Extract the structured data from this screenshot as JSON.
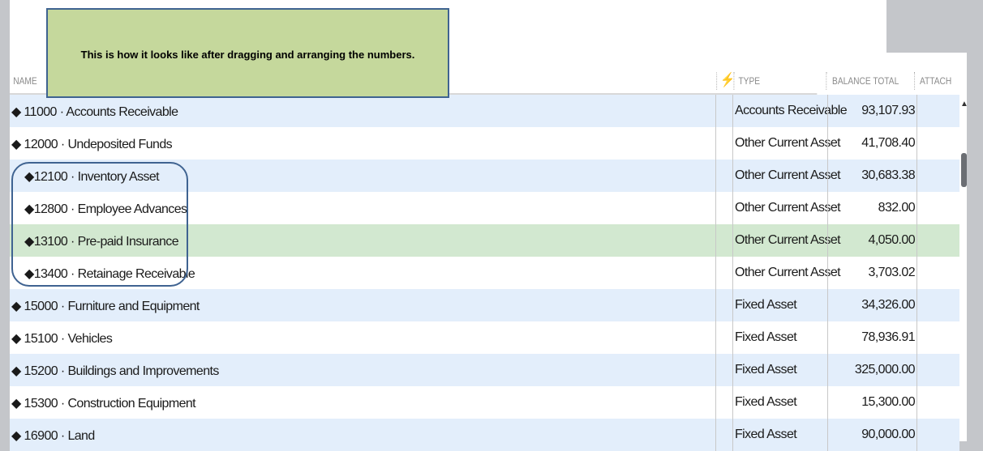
{
  "callout": "This is how it looks like after dragging and arranging the numbers.",
  "columns": {
    "name": "NAME",
    "type": "TYPE",
    "balance": "BALANCE TOTAL",
    "attach": "ATTACH"
  },
  "rows": [
    {
      "name": "◆ 11000 · Accounts Receivable",
      "type": "Accounts Receivable",
      "balance": "93,107.93",
      "sub": false
    },
    {
      "name": "◆ 12000 · Undeposited Funds",
      "type": "Other Current Asset",
      "balance": "41,708.40",
      "sub": false
    },
    {
      "name": "◆12100 · Inventory Asset",
      "type": "Other Current Asset",
      "balance": "30,683.38",
      "sub": true
    },
    {
      "name": "◆12800 · Employee Advances",
      "type": "Other Current Asset",
      "balance": "832.00",
      "sub": true
    },
    {
      "name": "◆13100 · Pre-paid Insurance",
      "type": "Other Current Asset",
      "balance": "4,050.00",
      "sub": true
    },
    {
      "name": "◆13400 · Retainage Receivable",
      "type": "Other Current Asset",
      "balance": "3,703.02",
      "sub": true
    },
    {
      "name": "◆ 15000 · Furniture and Equipment",
      "type": "Fixed Asset",
      "balance": "34,326.00",
      "sub": false
    },
    {
      "name": "◆ 15100 · Vehicles",
      "type": "Fixed Asset",
      "balance": "78,936.91",
      "sub": false
    },
    {
      "name": "◆ 15200 · Buildings and Improvements",
      "type": "Fixed Asset",
      "balance": "325,000.00",
      "sub": false
    },
    {
      "name": "◆ 15300 · Construction Equipment",
      "type": "Fixed Asset",
      "balance": "15,300.00",
      "sub": false
    },
    {
      "name": "◆ 16900 · Land",
      "type": "Fixed Asset",
      "balance": "90,000.00",
      "sub": false
    }
  ],
  "colors": {
    "row_alt": "#e3eefb",
    "row_selected": "#d2e8d0",
    "callout_bg": "#c5d89c",
    "accent": "#3f6391"
  }
}
